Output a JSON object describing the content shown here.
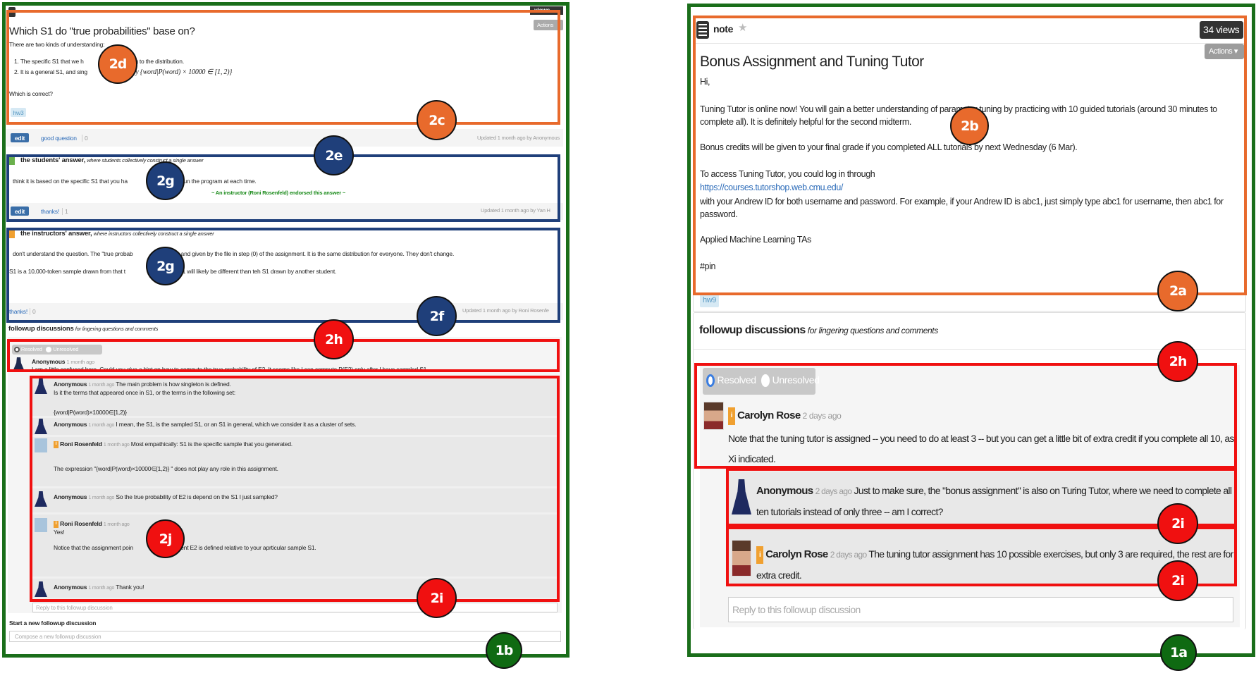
{
  "left": {
    "views_label": "views",
    "actions_label": "Actions",
    "title": "Which S1 do \"true probabilities\" base on?",
    "intro": "There are two kinds of understanding:",
    "item1_a": "1.  The specific S1 that we h",
    "item1_b": "according to the distribution.",
    "item2_a": "2.  It is a general S1, and sing",
    "item2_b": "efined by {word|P(word) × 10000 ∈ [1, 2)}",
    "question": "Which is correct?",
    "tag": "hw3",
    "edit_label": "edit",
    "good_question_label": "good question",
    "good_question_count": "0",
    "updated": "Updated 1 month ago by Anonymous",
    "students_answer": {
      "heading": "the students' answer,",
      "subheading": "where students collectively construct a single answer",
      "text_a": "think it is based on the specific S1 that you ha",
      "text_b": "when you run the program at each time.",
      "endorsed": "~ An instructor (Roni Rosenfeld) endorsed this answer ~",
      "edit_label": "edit",
      "thanks_label": "thanks!",
      "thanks_count": "1",
      "updated": "Updated 1 month ago by Yan H"
    },
    "instructors_answer": {
      "heading": "the instructors' answer,",
      "subheading": "where instructors collectively construct a single answer",
      "line1_a": "don't understand the question. The  \"true probab",
      "line1_b": "are fixed, and given by the file in step (0) of the assignment.  It is the same distribution for everyone.  They don't change.",
      "line2_a": "S1 is a 10,000-token sample drawn from that t",
      "line2_b": "n.  Your S1 will likely be different than teh S1 drawn by another student.",
      "thanks_label": "thanks!",
      "thanks_count": "0",
      "updated": "Updated 1 month ago by Roni Rosenfe"
    },
    "followup": {
      "heading": "followup discussions",
      "subheading": "for lingering questions and comments",
      "resolved_label": "Resolved",
      "unresolved_label": "Unresolved",
      "resolved": true,
      "main": {
        "author": "Anonymous",
        "time": "1 month ago",
        "text": "I am a little confused here. Could you give a hint on how to compute the true probability of E2. It seems like I can compute P(E2) only after I have sampled S1."
      },
      "replies": [
        {
          "author": "Anonymous",
          "time": "1 month ago",
          "text": "The main problem is how singleton is defined.",
          "line2": "Is it the terms that appeared once in S1, or the terms in the following set:",
          "line3": "{word|P(word)×10000∈[1,2)}"
        },
        {
          "author": "Anonymous",
          "time": "1 month ago",
          "text": "I mean, the S1, is the sampled S1, or an S1 in general, which we consider it as a cluster of sets."
        },
        {
          "author": "Roni Rosenfeld",
          "time": "1 month ago",
          "instructor": true,
          "text": "Most empathically: S1 is the specific sample that you generated.",
          "line2": "The expression \"{word|P(word)×10000∈[1,2)} \" does not play any role in this assignment."
        },
        {
          "author": "Anonymous",
          "time": "1 month ago",
          "text": "So the true probability of E2 is depend on the S1 I just sampled?"
        },
        {
          "author": "Roni Rosenfeld",
          "time": "1 month ago",
          "instructor": true,
          "text": "",
          "line2": "Yes!",
          "line3_a": "Notice that the assignment poin",
          "line3_b": "e event E2 is defined relative to your aprticular sample S1."
        },
        {
          "author": "Anonymous",
          "time": "1 month ago",
          "text": "Thank you!"
        }
      ],
      "reply_placeholder": "Reply to this followup discussion",
      "start_new_label": "Start a new followup discussion",
      "compose_placeholder": "Compose a new followup discussion"
    }
  },
  "right": {
    "post_type": "note",
    "views": "34 views",
    "actions_label": "Actions",
    "title": "Bonus Assignment and Tuning Tutor",
    "greeting": "Hi,",
    "para1": "Tuning Tutor is online now! You will gain a better understanding of parameter tuning by practicing with 10 guided tutorials (around 30 minutes to complete all). It is definitely helpful for the second midterm.",
    "para2": "Bonus credits will be given to your final grade if you completed ALL tutorials by next Wednesday (6 Mar).",
    "para3": "To access Tuning Tutor, you could log in through",
    "link": "https://courses.tutorshop.web.cmu.edu/",
    "para4": "with your Andrew ID for both username and password. For example, if your Andrew ID is abc1, just simply type abc1 for username, then abc1 for password.",
    "signature": "Applied Machine Learning TAs",
    "pin": "#pin",
    "tag": "hw9",
    "followup": {
      "heading": "followup discussions",
      "subheading": "for lingering questions and comments",
      "resolved_label": "Resolved",
      "unresolved_label": "Unresolved",
      "resolved": true,
      "main": {
        "author": "Carolyn Rose",
        "time": "2 days ago",
        "instructor": true,
        "text": "Note that the tuning tutor is assigned -- you need to do at least 3 -- but you can get a little bit of extra credit if you complete all 10, as Xi indicated."
      },
      "replies": [
        {
          "author": "Anonymous",
          "time": "2 days ago",
          "text": "Just to make sure, the \"bonus assignment\" is also on Turing Tutor, where we need to complete all ten tutorials instead of only three -- am I correct?"
        },
        {
          "author": "Carolyn Rose",
          "time": "2 days ago",
          "instructor": true,
          "text": "The tuning tutor assignment has 10 possible exercises, but only 3 are required, the rest are for extra credit."
        }
      ],
      "reply_placeholder": "Reply to this followup discussion"
    }
  },
  "annotations": {
    "a1a": "1a",
    "a1b": "1b",
    "a2a": "2a",
    "a2b": "2b",
    "a2c": "2c",
    "a2d": "2d",
    "a2e": "2e",
    "a2f": "2f",
    "a2g": "2g",
    "a2h": "2h",
    "a2i": "2i",
    "a2j": "2j"
  },
  "colors": {
    "orange": "#e86a2c",
    "blue": "#1f3f7a",
    "red": "#f01010",
    "green": "#0f6a12",
    "link": "#2a6ab8",
    "endorse": "#1a8a1a"
  }
}
